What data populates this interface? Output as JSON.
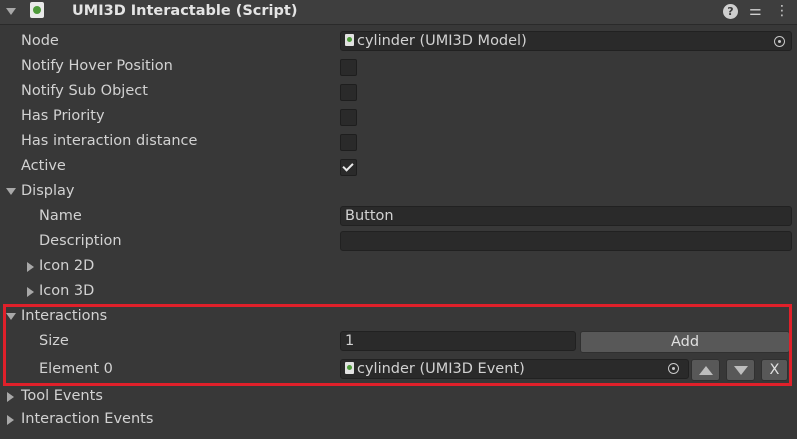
{
  "header": {
    "title": "UMI3D Interactable (Script)"
  },
  "fields": {
    "node": {
      "label": "Node",
      "value": "cylinder (UMI3D Model)"
    },
    "notify_hover": {
      "label": "Notify Hover Position",
      "checked": false
    },
    "notify_sub": {
      "label": "Notify Sub Object",
      "checked": false
    },
    "has_priority": {
      "label": "Has Priority",
      "checked": false
    },
    "has_interaction_distance": {
      "label": "Has interaction distance",
      "checked": false
    },
    "active": {
      "label": "Active",
      "checked": true
    }
  },
  "display": {
    "label": "Display",
    "name_label": "Name",
    "name_value": "Button",
    "description_label": "Description",
    "description_value": "",
    "icon2d_label": "Icon 2D",
    "icon3d_label": "Icon 3D"
  },
  "interactions": {
    "label": "Interactions",
    "size_label": "Size",
    "size_value": "1",
    "add_label": "Add",
    "element0_label": "Element 0",
    "element0_value": "cylinder (UMI3D Event)",
    "remove_label": "X"
  },
  "tool_events": {
    "label": "Tool Events"
  },
  "interaction_events": {
    "label": "Interaction Events"
  },
  "colors": {
    "highlight": "#e0202a",
    "background": "#383838"
  }
}
